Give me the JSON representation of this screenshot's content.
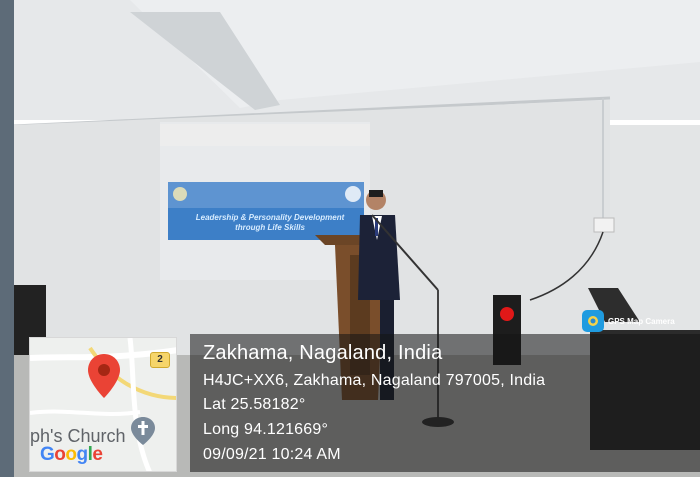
{
  "overlay": {
    "place": "Zakhama, Nagaland, India",
    "address": "H4JC+XX6, Zakhama, Nagaland 797005, India",
    "lat": "Lat 25.58182°",
    "long": "Long 94.121669°",
    "datetime": "09/09/21 10:24 AM"
  },
  "watermark": {
    "text": "GPS Map Camera"
  },
  "map": {
    "church_label": "ph's Church",
    "road_number": "2",
    "logo": "Google"
  },
  "slide": {
    "title_line1": "Leadership & Personality Development",
    "title_line2": "through Life Skills"
  },
  "colors": {
    "overlay_bg": "#141414",
    "pin": "#ea4335",
    "slide_blue": "#2f7fd0"
  }
}
